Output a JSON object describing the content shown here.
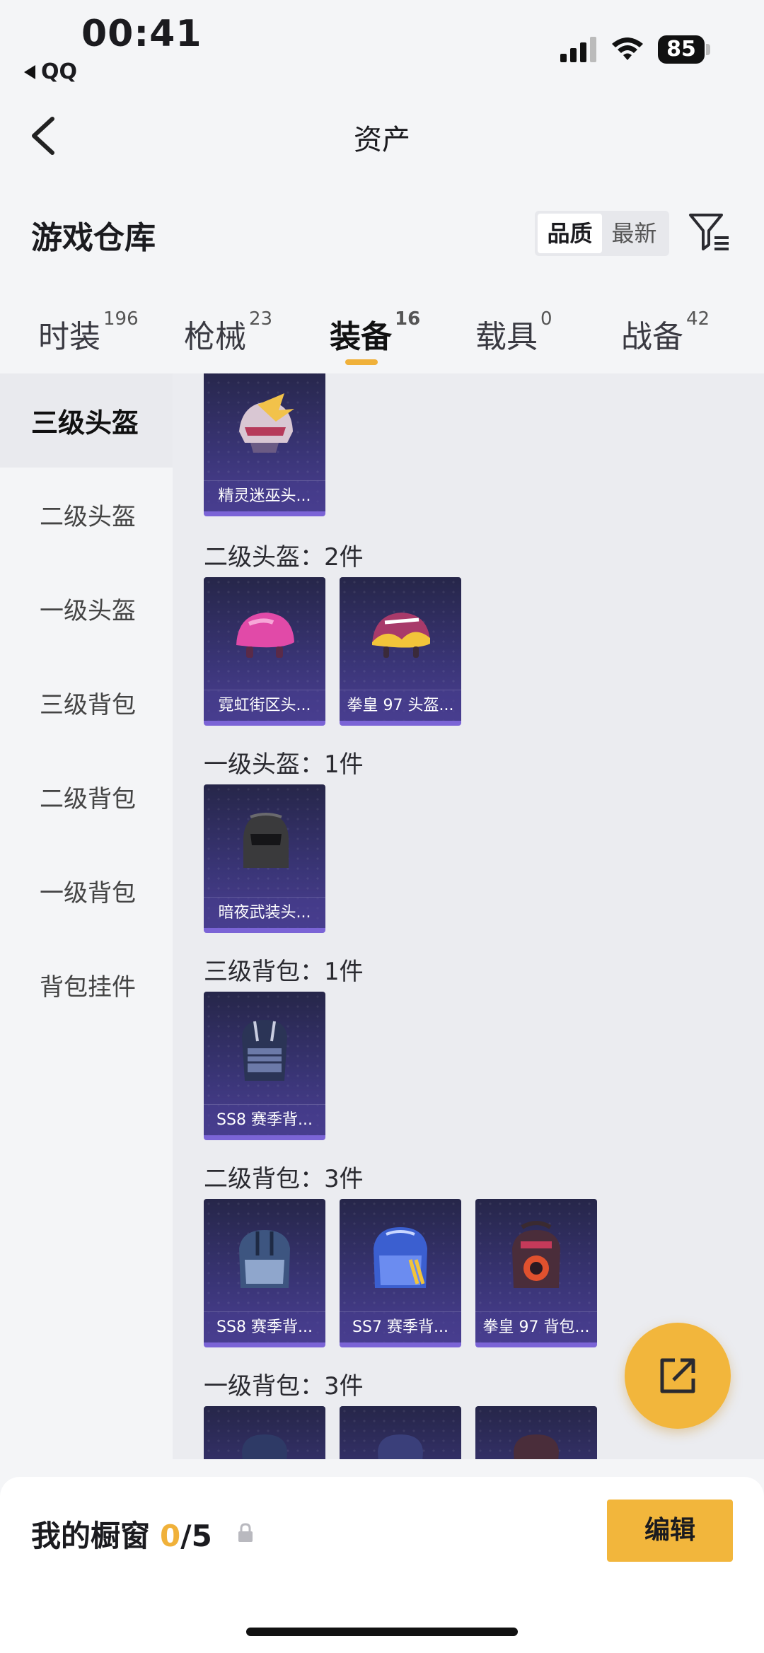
{
  "status_bar": {
    "time": "00:41",
    "back_app": "QQ",
    "battery": "85"
  },
  "nav": {
    "title": "资产"
  },
  "warehouse": {
    "title": "游戏仓库",
    "sort_options": [
      "品质",
      "最新"
    ],
    "sort_selected": "品质"
  },
  "tabs": [
    {
      "label": "时装",
      "count": "196"
    },
    {
      "label": "枪械",
      "count": "23"
    },
    {
      "label": "装备",
      "count": "16"
    },
    {
      "label": "载具",
      "count": "0"
    },
    {
      "label": "战备",
      "count": "42"
    }
  ],
  "active_tab": "装备",
  "sidebar": {
    "items": [
      "三级头盔",
      "二级头盔",
      "一级头盔",
      "三级背包",
      "二级背包",
      "一级背包",
      "背包挂件"
    ],
    "active": "三级头盔"
  },
  "groups": [
    {
      "label": "",
      "items": [
        {
          "name": "精灵迷巫头...",
          "icon": "helmet-elf-icon"
        }
      ]
    },
    {
      "label": "二级头盔：2件",
      "items": [
        {
          "name": "霓虹街区头...",
          "icon": "helmet-pink-icon"
        },
        {
          "name": "拳皇 97 头盔...",
          "icon": "helmet-kof-icon"
        }
      ]
    },
    {
      "label": "一级头盔：1件",
      "items": [
        {
          "name": "暗夜武装头...",
          "icon": "helmet-dark-icon"
        }
      ]
    },
    {
      "label": "三级背包：1件",
      "items": [
        {
          "name": "SS8 赛季背...",
          "icon": "backpack-ss8-icon"
        }
      ]
    },
    {
      "label": "二级背包：3件",
      "items": [
        {
          "name": "SS8 赛季背...",
          "icon": "backpack-ss8-icon"
        },
        {
          "name": "SS7 赛季背...",
          "icon": "backpack-ss7-icon"
        },
        {
          "name": "拳皇 97 背包...",
          "icon": "backpack-kof-icon"
        }
      ]
    },
    {
      "label": "一级背包：3件",
      "items": [
        {
          "name": "",
          "icon": "backpack-icon"
        },
        {
          "name": "",
          "icon": "backpack-icon"
        },
        {
          "name": "",
          "icon": "backpack-icon"
        }
      ]
    }
  ],
  "showcase": {
    "title": "我的橱窗",
    "current": "0",
    "total": "/5",
    "edit_label": "编辑"
  },
  "colors": {
    "accent": "#f2b63c",
    "card_bg": "#3a3577",
    "card_border": "#7b64d6"
  }
}
